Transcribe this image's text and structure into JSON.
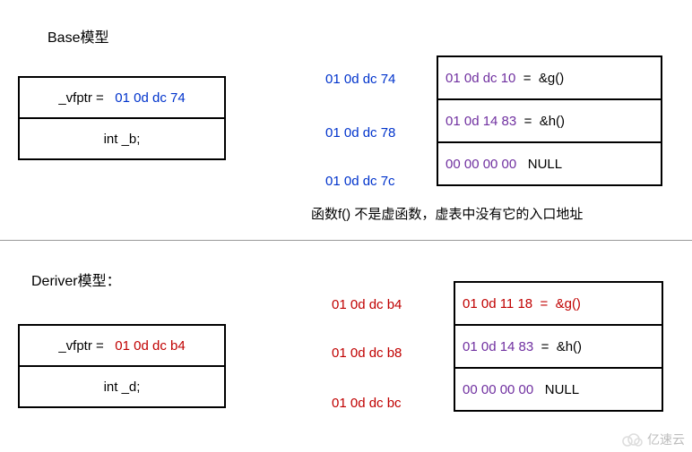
{
  "base": {
    "title": "Base模型",
    "obj": {
      "vfptr_label": "_vfptr =",
      "vfptr_value": "01 0d dc 74",
      "member": "int _b;"
    },
    "addrs": [
      "01 0d dc 74",
      "01 0d dc 78",
      "01 0d dc 7c"
    ],
    "vtable": [
      {
        "val": "01 0d dc 10",
        "eq": "=",
        "fn": "&g()"
      },
      {
        "val": "01 0d 14 83",
        "eq": "=",
        "fn": "&h()"
      },
      {
        "val": "00 00 00 00",
        "eq": "",
        "fn": "NULL"
      }
    ],
    "caption": "函数f() 不是虚函数，虚表中没有它的入口地址"
  },
  "deriver": {
    "title": "Deriver模型：",
    "obj": {
      "vfptr_label": "_vfptr =",
      "vfptr_value": "01 0d dc b4",
      "member": "int _d;"
    },
    "addrs": [
      "01 0d dc b4",
      "01 0d dc b8",
      "01 0d dc bc"
    ],
    "vtable": [
      {
        "val": "01 0d 11 18",
        "eq": "=",
        "fn": "&g()"
      },
      {
        "val": "01 0d 14 83",
        "eq": "=",
        "fn": "&h()"
      },
      {
        "val": "00 00 00 00",
        "eq": "",
        "fn": "NULL"
      }
    ]
  },
  "watermark": "亿速云"
}
